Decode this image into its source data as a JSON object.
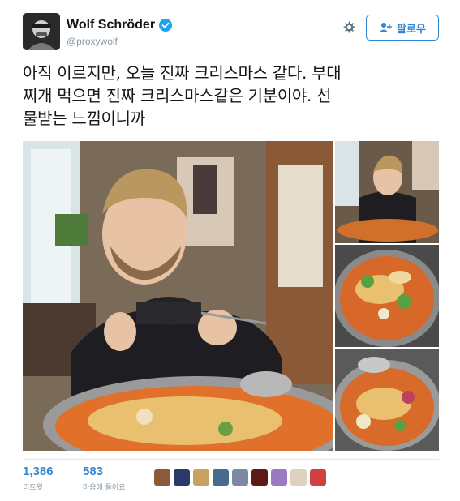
{
  "user": {
    "display_name": "Wolf Schröder",
    "handle": "@proxywolf",
    "verified": true
  },
  "actions": {
    "follow_label": "팔로우",
    "settings_icon": "gear-icon",
    "follow_icon": "add-user-icon"
  },
  "tweet": {
    "lines": [
      "아직 이르지만, 오늘 진짜 크리스마스 같다. 부대",
      "찌개 먹으면 진짜 크리스마스같은 기분이야. 선",
      "물받는 느낌이니까"
    ]
  },
  "stats": {
    "retweets": {
      "value": "1,386",
      "label": "리트윗"
    },
    "likes": {
      "value": "583",
      "label": "마음에 들어요"
    }
  },
  "likers": [
    {
      "color": "#8a5a3a"
    },
    {
      "color": "#2a3a6a"
    },
    {
      "color": "#c8a060"
    },
    {
      "color": "#4a6a8a"
    },
    {
      "color": "#7a8aa0"
    },
    {
      "color": "#5a1a1a"
    },
    {
      "color": "#9a7ac0"
    },
    {
      "color": "#e0d0c0"
    },
    {
      "color": "#d04040"
    }
  ],
  "colors": {
    "accent": "#2f86d5",
    "text": "#14171a",
    "muted": "#8899a6",
    "verified": "#1da1f2"
  }
}
